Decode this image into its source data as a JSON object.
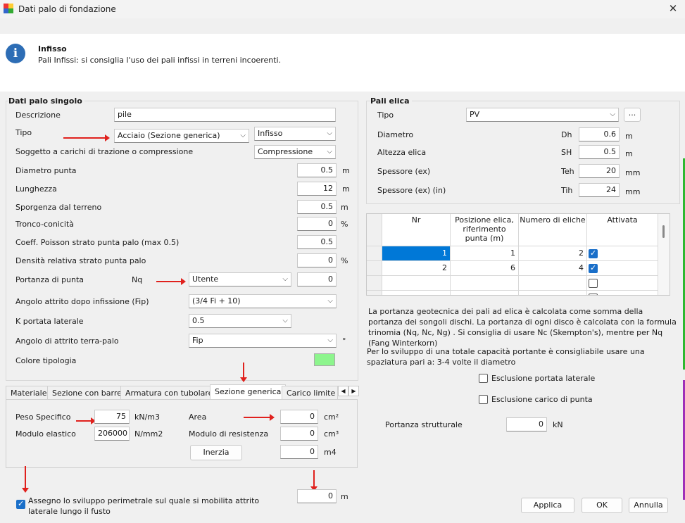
{
  "window": {
    "title": "Dati palo di fondazione",
    "close": "✕"
  },
  "header": {
    "title": "Infisso",
    "subtitle": "Pali Infissi: si consiglia l'uso dei pali infissi in terreni incoerenti."
  },
  "single": {
    "title": "Dati palo singolo",
    "descrizione_label": "Descrizione",
    "descrizione_value": "pile",
    "tipo_label": "Tipo",
    "tipo_value": "Acciaio (Sezione generica)",
    "tipo2_value": "Infisso",
    "soggetto_label": "Soggetto a carichi di trazione o compressione",
    "soggetto_value": "Compressione",
    "diametro_label": "Diametro punta",
    "diametro_value": "0.5",
    "diametro_unit": "m",
    "lunghezza_label": "Lunghezza",
    "lunghezza_value": "12",
    "lunghezza_unit": "m",
    "sporgenza_label": "Sporgenza dal terreno",
    "sporgenza_value": "0.5",
    "sporgenza_unit": "m",
    "tronco_label": "Tronco-conicità",
    "tronco_value": "0",
    "tronco_unit": "%",
    "poisson_label": "Coeff. Poisson strato punta palo (max 0.5)",
    "poisson_value": "0.5",
    "densita_label": "Densità relativa strato punta palo",
    "densita_value": "0",
    "densita_unit": "%",
    "portanza_label": "Portanza di punta",
    "portanza_nq": "Nq",
    "portanza_select": "Utente",
    "portanza_value": "0",
    "angolo_label": "Angolo attrito dopo infissione (Fip)",
    "angolo_value": "(3/4 Fi + 10)",
    "k_label": "K portata laterale",
    "k_value": "0.5",
    "angolo_tp_label": "Angolo di attrito terra-palo",
    "angolo_tp_value": "Fip",
    "angolo_tp_unit": "°",
    "colore_label": "Colore tipologia",
    "colore_hex": "#8df58d"
  },
  "tabs": [
    "Materiale",
    "Sezione con barre",
    "Armatura con tubolare",
    "Sezione generica",
    "Carico limite o"
  ],
  "section": {
    "peso_label": "Peso Specifico",
    "peso_value": "75",
    "peso_unit": "kN/m3",
    "modulo_label": "Modulo elastico",
    "modulo_value": "206000",
    "modulo_unit": "N/mm2",
    "area_label": "Area",
    "area_value": "0",
    "area_unit": "cm²",
    "modres_label": "Modulo di resistenza",
    "modres_value": "0",
    "modres_unit": "cm³",
    "inerzia_button": "Inerzia",
    "inerzia_value": "0",
    "inerzia_unit": "m4"
  },
  "perimetro": {
    "label": "Assegno lo sviluppo perimetrale sul quale si mobilita attrito laterale lungo il fusto",
    "value": "0",
    "unit": "m"
  },
  "elica": {
    "title": "Pali elica",
    "tipo_label": "Tipo",
    "tipo_value": "PV",
    "more_button": "...",
    "diametro_label": "Diametro",
    "diametro_sym": "Dh",
    "diametro_value": "0.6",
    "diametro_unit": "m",
    "altezza_label": "Altezza elica",
    "altezza_sym": "SH",
    "altezza_value": "0.5",
    "altezza_unit": "m",
    "spessore_label": "Spessore (ex)",
    "spessore_sym": "Teh",
    "spessore_value": "20",
    "spessore_unit": "mm",
    "spessorein_label": "Spessore (ex) (in)",
    "spessorein_sym": "Tih",
    "spessorein_value": "24",
    "spessorein_unit": "mm"
  },
  "grid": {
    "headers": [
      "Nr",
      "Posizione elica, riferimento punta (m)",
      "Numero di eliche",
      "Attivata"
    ],
    "rows": [
      {
        "nr": "1",
        "pos": "1",
        "num": "2",
        "on": true
      },
      {
        "nr": "2",
        "pos": "6",
        "num": "4",
        "on": true
      },
      {
        "nr": "",
        "pos": "",
        "num": "",
        "on": false
      }
    ]
  },
  "notes": {
    "p1": "La portanza geotecnica dei pali ad elica è calcolata come somma della portanza dei songoli dischi. La portanza di ogni disco è calcolata con la formula trinomia (Nq, Nc, Ng) . Si consiglia di usare Nc (Skempton's), mentre per Nq (Fang Winterkorn)",
    "p2": "Per lo sviluppo di una totale capacità portante è consigliabile usare una spaziatura pari a: 3-4 volte il diametro"
  },
  "options": {
    "esclusione_laterale": "Esclusione portata laterale",
    "esclusione_punta": "Esclusione carico di punta"
  },
  "strutturale": {
    "label": "Portanza strutturale",
    "value": "0",
    "unit": "kN"
  },
  "buttons": {
    "applica": "Applica",
    "ok": "OK",
    "annulla": "Annulla"
  }
}
